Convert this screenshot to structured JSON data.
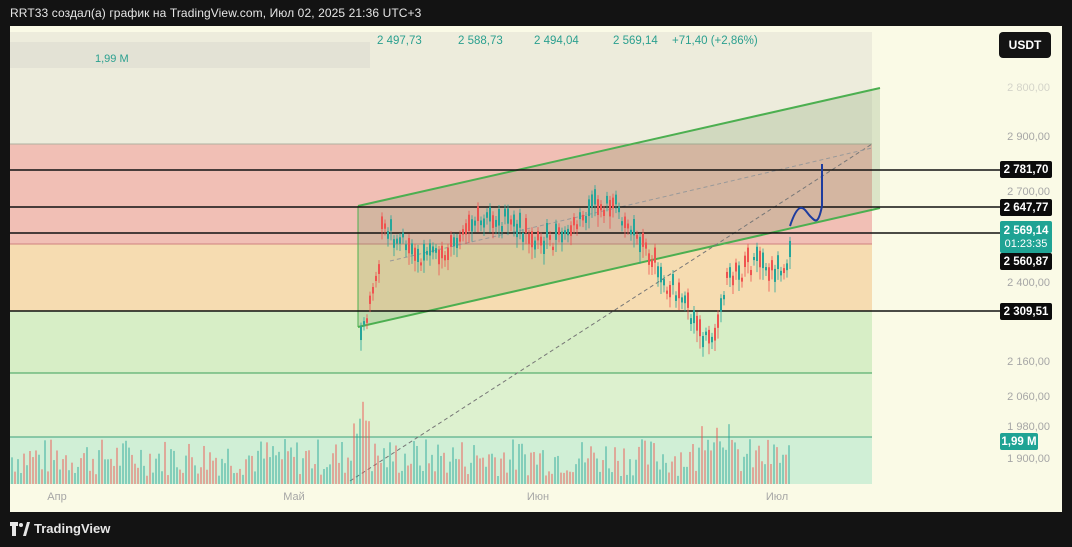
{
  "header": {
    "title": "RRT33 создал(а) график на TradingView.com, Июл 02, 2025 21:36 UTC+3"
  },
  "legend": {
    "open": "2 497,73",
    "high": "2 588,73",
    "low": "2 494,04",
    "close": "2 569,14",
    "change": "+71,40 (+2,86%)",
    "volume": "1,99 M"
  },
  "currency_button": "USDT",
  "y_axis_ticks": [
    "2 800,00",
    "2 900,00",
    "2 700,00",
    "2 400,00",
    "2 160,00",
    "2 060,00",
    "1 980,00",
    "1 900,00"
  ],
  "price_levels": [
    "2 781,70",
    "2 647,77",
    "2 560,87",
    "2 309,51"
  ],
  "current_price": {
    "price": "2 569,14",
    "countdown": "01:23:35",
    "color": "#1fa394"
  },
  "volume_badge": "1,99 M",
  "x_axis": [
    "Апр",
    "Май",
    "Июн",
    "Июл"
  ],
  "footer": {
    "brand": "TradingView"
  },
  "colors": {
    "background": "#131313",
    "chart_bg": "#fafae6",
    "red_zone": "#efb4ab",
    "orange_zone": "#f5d6a7",
    "green_zone": "#d3ecc2",
    "teal_zone": "#cdeed5",
    "channel": "#4caf50",
    "bull": "#26a69a",
    "bear": "#ef5350",
    "projection": "#1e3c9e"
  }
}
